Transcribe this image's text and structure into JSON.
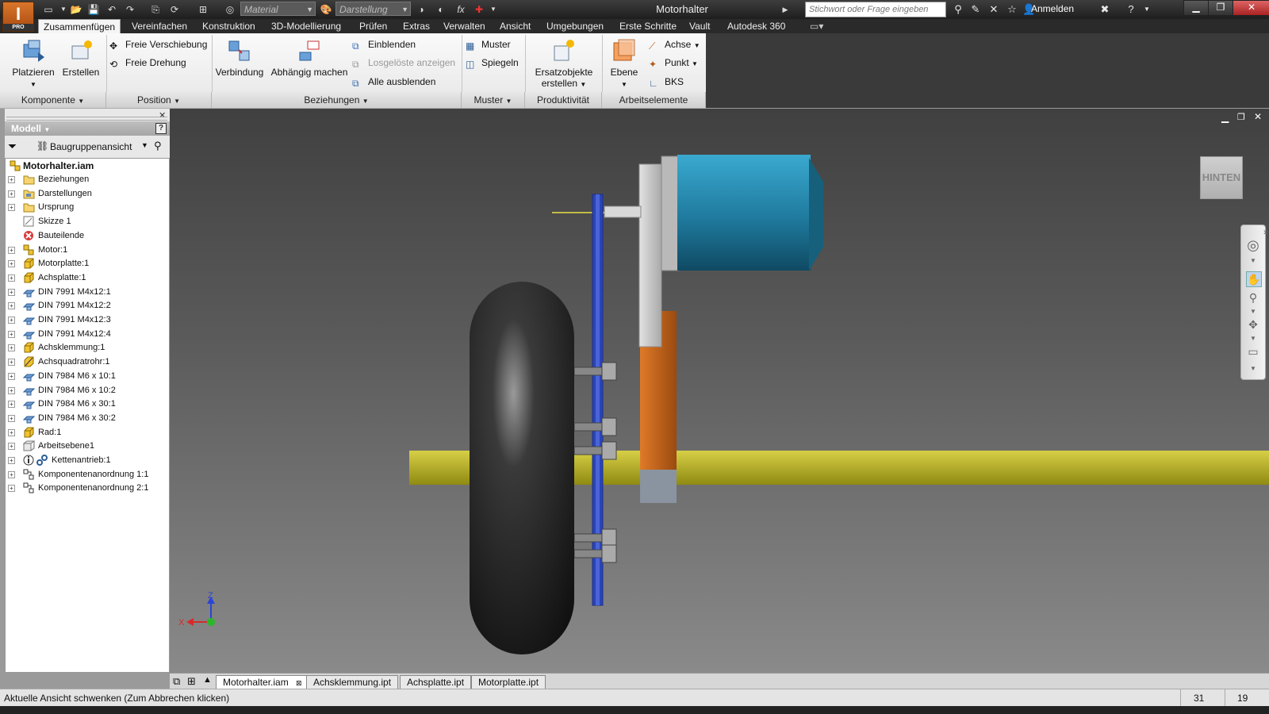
{
  "app": {
    "logo_letter": "I",
    "logo_sub": "PRO",
    "window_title": "Motorhalter",
    "material_combo": "Material",
    "appearance_combo": "Darstellung",
    "search_placeholder": "Stichwort oder Frage eingeben",
    "login_label": "Anmelden"
  },
  "tabs": [
    {
      "label": "Zusammenfügen",
      "active": true
    },
    {
      "label": "Vereinfachen"
    },
    {
      "label": "Konstruktion"
    },
    {
      "label": "3D-Modellierung"
    },
    {
      "label": "Prüfen"
    },
    {
      "label": "Extras"
    },
    {
      "label": "Verwalten"
    },
    {
      "label": "Ansicht"
    },
    {
      "label": "Umgebungen"
    },
    {
      "label": "Erste Schritte"
    },
    {
      "label": "Vault"
    },
    {
      "label": "Autodesk 360"
    }
  ],
  "ribbon": {
    "komponente": {
      "title": "Komponente",
      "platzieren": "Platzieren",
      "erstellen": "Erstellen"
    },
    "position": {
      "title": "Position",
      "freie_verschiebung": "Freie Verschiebung",
      "freie_drehung": "Freie Drehung"
    },
    "beziehungen": {
      "title": "Beziehungen",
      "verbindung": "Verbindung",
      "abhaengig": "Abhängig machen",
      "einblenden": "Einblenden",
      "losgeloeste": "Losgelöste anzeigen",
      "alle_ausblenden": "Alle ausblenden"
    },
    "muster": {
      "title": "Muster",
      "muster": "Muster",
      "spiegeln": "Spiegeln"
    },
    "produktivitaet": {
      "title": "Produktivität",
      "ersatz_line1": "Ersatzobjekte",
      "ersatz_line2": "erstellen"
    },
    "arbeitselemente": {
      "title": "Arbeitselemente",
      "ebene": "Ebene",
      "achse": "Achse",
      "punkt": "Punkt",
      "bks": "BKS"
    }
  },
  "browser": {
    "title": "Modell",
    "view_label": "Baugruppenansicht",
    "root": "Motorhalter.iam",
    "items": [
      {
        "label": "Beziehungen",
        "icon": "folder"
      },
      {
        "label": "Darstellungen",
        "icon": "folder-rep"
      },
      {
        "label": "Ursprung",
        "icon": "folder"
      },
      {
        "label": "Skizze 1",
        "icon": "sketch"
      },
      {
        "label": "Bauteilende",
        "icon": "end-of-part"
      },
      {
        "label": "Motor:1",
        "icon": "assembly"
      },
      {
        "label": "Motorplatte:1",
        "icon": "part"
      },
      {
        "label": "Achsplatte:1",
        "icon": "part"
      },
      {
        "label": "DIN 7991 M4x12:1",
        "icon": "screw"
      },
      {
        "label": "DIN 7991 M4x12:2",
        "icon": "screw"
      },
      {
        "label": "DIN 7991 M4x12:3",
        "icon": "screw"
      },
      {
        "label": "DIN 7991 M4x12:4",
        "icon": "screw"
      },
      {
        "label": "Achsklemmung:1",
        "icon": "part"
      },
      {
        "label": "Achsquadratrohr:1",
        "icon": "part-frame"
      },
      {
        "label": "DIN 7984 M6 x 10:1",
        "icon": "screw"
      },
      {
        "label": "DIN 7984 M6 x 10:2",
        "icon": "screw"
      },
      {
        "label": "DIN 7984 M6 x 30:1",
        "icon": "screw"
      },
      {
        "label": "DIN 7984 M6 x 30:2",
        "icon": "screw"
      },
      {
        "label": "Rad:1",
        "icon": "part"
      },
      {
        "label": "Arbeitsebene1",
        "icon": "workplane"
      },
      {
        "label": "Kettenantrieb:1",
        "icon": "chain"
      },
      {
        "label": "Komponentenanordnung 1:1",
        "icon": "pattern"
      },
      {
        "label": "Komponentenanordnung 2:1",
        "icon": "pattern"
      }
    ]
  },
  "viewcube_label": "HINTEN",
  "axes": {
    "z": "Z",
    "x": "X"
  },
  "doc_tabs": [
    {
      "label": "Motorhalter.iam",
      "active": true
    },
    {
      "label": "Achsklemmung.ipt"
    },
    {
      "label": "Achsplatte.ipt"
    },
    {
      "label": "Motorplatte.ipt"
    }
  ],
  "status": {
    "text": "Aktuelle Ansicht schwenken (Zum Abbrechen klicken)",
    "n1": "31",
    "n2": "19"
  },
  "colors": {
    "motor": "#1f7a9e",
    "axle": "#bdb52a",
    "bracket": "#c9661a",
    "sprocket": "#2a44b8",
    "wheel": "#2a2a2a"
  }
}
